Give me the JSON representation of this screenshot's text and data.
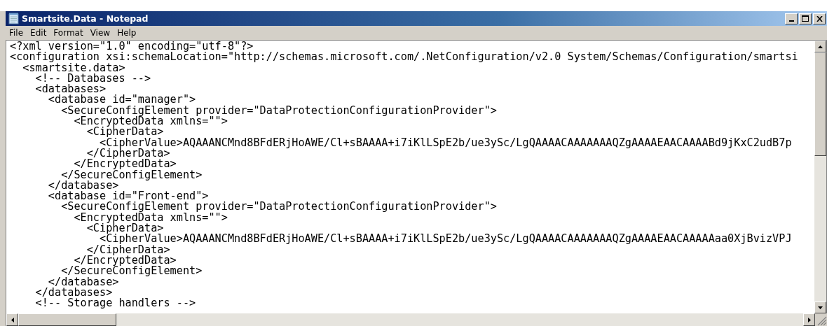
{
  "window": {
    "title": "Smartsite.Data - Notepad"
  },
  "menu": [
    "File",
    "Edit",
    "Format",
    "View",
    "Help"
  ],
  "lines": [
    "<?xml version=\"1.0\" encoding=\"utf-8\"?>",
    "<configuration xsi:schemaLocation=\"http://schemas.microsoft.com/.NetConfiguration/v2.0 System/Schemas/Configuration/smartsi",
    "  <smartsite.data>",
    "    <!-- Databases -->",
    "    <databases>",
    "      <database id=\"manager\">",
    "        <SecureConfigElement provider=\"DataProtectionConfigurationProvider\">",
    "          <EncryptedData xmlns=\"\">",
    "            <CipherData>",
    "              <CipherValue>AQAAANCMnd8BFdERjHoAWE/Cl+sBAAAA+i7iKlLSpE2b/ue3ySc/LgQAAAACAAAAAAAQZgAAAAEAACAAAABd9jKxC2udB7p",
    "            </CipherData>",
    "          </EncryptedData>",
    "        </SecureConfigElement>",
    "      </database>",
    "      <database id=\"Front-end\">",
    "        <SecureConfigElement provider=\"DataProtectionConfigurationProvider\">",
    "          <EncryptedData xmlns=\"\">",
    "            <CipherData>",
    "              <CipherValue>AQAAANCMnd8BFdERjHoAWE/Cl+sBAAAA+i7iKlLSpE2b/ue3ySc/LgQAAAACAAAAAAAQZgAAAAEAACAAAAAaa0XjBvizVPJ",
    "            </CipherData>",
    "          </EncryptedData>",
    "        </SecureConfigElement>",
    "      </database>",
    "    </databases>",
    "    <!-- Storage handlers -->"
  ]
}
